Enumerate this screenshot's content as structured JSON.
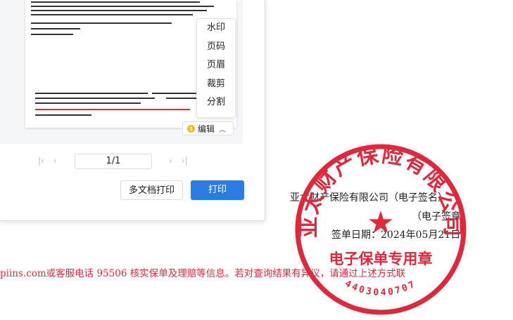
{
  "dialog": {
    "menu": [
      "水印",
      "页码",
      "页眉",
      "裁剪",
      "分割"
    ],
    "edit_label": "编辑",
    "page_indicator": "1/1",
    "multi_print_label": "多文档打印",
    "print_label": "打印"
  },
  "document": {
    "company_line": "亚太财产保险有限公司（电子签名）",
    "seal_line": "（电子签章）",
    "sign_date": "签单日期：2024年05月21日",
    "notice": "piins.com或客服电话 95506 核实保单及理赔等信息。若对查询结果有异议，请通过上述方式联"
  },
  "seal": {
    "top_text": "亚太财产保险有限公司",
    "bottom_text": "电子保单专用章",
    "serial": "4403040707",
    "color": "#e0283c"
  },
  "colors": {
    "primary": "#2a7de1",
    "seal": "#e0283c"
  }
}
